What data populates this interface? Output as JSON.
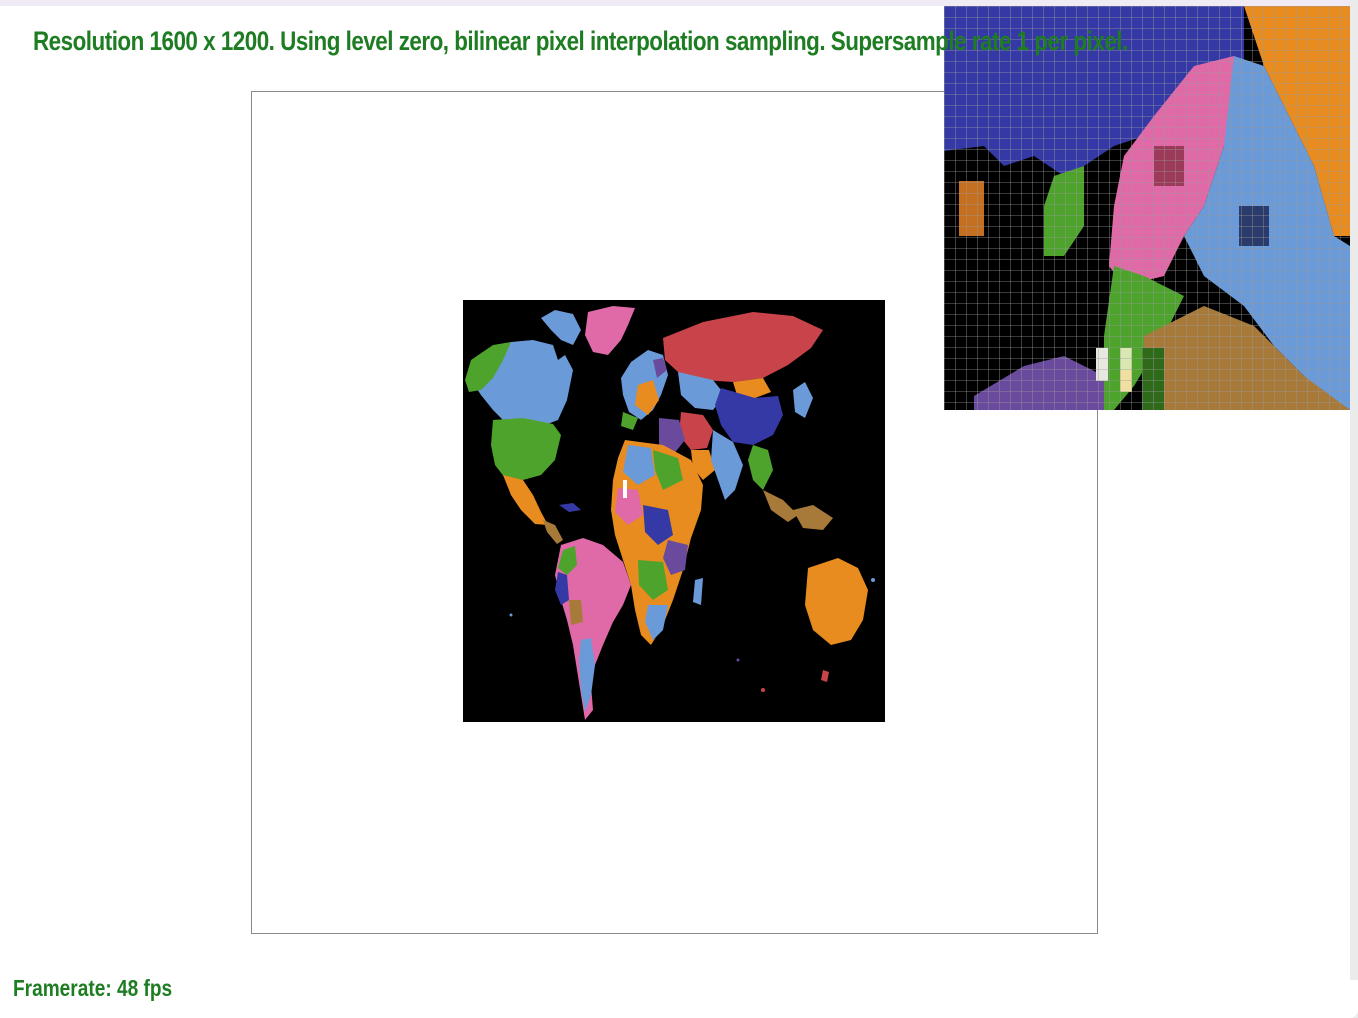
{
  "header": {
    "text": "Resolution 1600 x 1200. Using level zero, bilinear pixel interpolation sampling. Supersample rate 1 per pixel."
  },
  "status": {
    "framerate": "Framerate: 48 fps"
  },
  "colors": {
    "text_green": "#1e7d22",
    "map_background": "#000000",
    "region_red": "#c8444a",
    "region_blue": "#6b9ad8",
    "region_dark_blue": "#3539a6",
    "region_green": "#4ea32c",
    "region_pink": "#e06aa8",
    "region_orange": "#e98c1f",
    "region_brown": "#a87a3a",
    "region_purple": "#6a4a9c"
  },
  "icons": {
    "map": "world-map-texture",
    "zoom": "pixel-inspector-zoom"
  }
}
